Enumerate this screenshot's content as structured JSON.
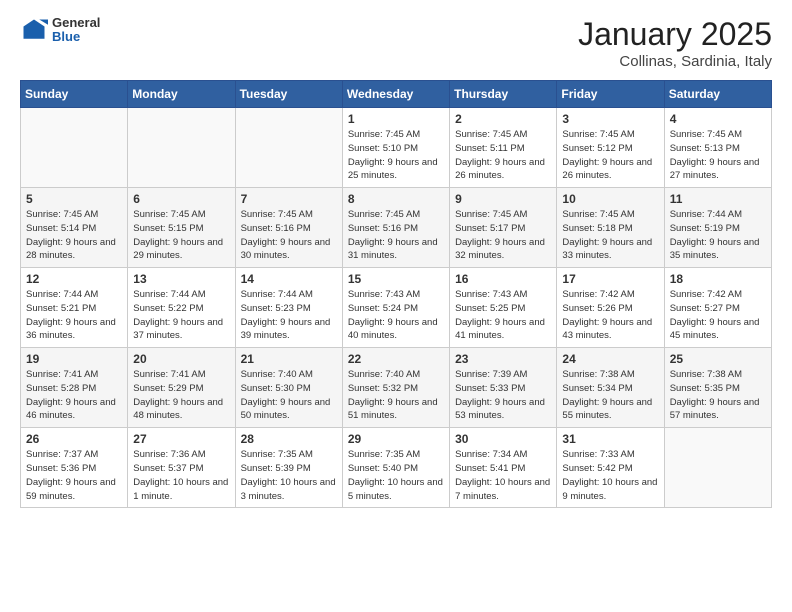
{
  "header": {
    "logo": {
      "general": "General",
      "blue": "Blue"
    },
    "month": "January 2025",
    "location": "Collinas, Sardinia, Italy"
  },
  "weekdays": [
    "Sunday",
    "Monday",
    "Tuesday",
    "Wednesday",
    "Thursday",
    "Friday",
    "Saturday"
  ],
  "weeks": [
    [
      {
        "day": null
      },
      {
        "day": null
      },
      {
        "day": null
      },
      {
        "day": 1,
        "sunrise": "7:45 AM",
        "sunset": "5:10 PM",
        "daylight": "9 hours and 25 minutes."
      },
      {
        "day": 2,
        "sunrise": "7:45 AM",
        "sunset": "5:11 PM",
        "daylight": "9 hours and 26 minutes."
      },
      {
        "day": 3,
        "sunrise": "7:45 AM",
        "sunset": "5:12 PM",
        "daylight": "9 hours and 26 minutes."
      },
      {
        "day": 4,
        "sunrise": "7:45 AM",
        "sunset": "5:13 PM",
        "daylight": "9 hours and 27 minutes."
      }
    ],
    [
      {
        "day": 5,
        "sunrise": "7:45 AM",
        "sunset": "5:14 PM",
        "daylight": "9 hours and 28 minutes."
      },
      {
        "day": 6,
        "sunrise": "7:45 AM",
        "sunset": "5:15 PM",
        "daylight": "9 hours and 29 minutes."
      },
      {
        "day": 7,
        "sunrise": "7:45 AM",
        "sunset": "5:16 PM",
        "daylight": "9 hours and 30 minutes."
      },
      {
        "day": 8,
        "sunrise": "7:45 AM",
        "sunset": "5:16 PM",
        "daylight": "9 hours and 31 minutes."
      },
      {
        "day": 9,
        "sunrise": "7:45 AM",
        "sunset": "5:17 PM",
        "daylight": "9 hours and 32 minutes."
      },
      {
        "day": 10,
        "sunrise": "7:45 AM",
        "sunset": "5:18 PM",
        "daylight": "9 hours and 33 minutes."
      },
      {
        "day": 11,
        "sunrise": "7:44 AM",
        "sunset": "5:19 PM",
        "daylight": "9 hours and 35 minutes."
      }
    ],
    [
      {
        "day": 12,
        "sunrise": "7:44 AM",
        "sunset": "5:21 PM",
        "daylight": "9 hours and 36 minutes."
      },
      {
        "day": 13,
        "sunrise": "7:44 AM",
        "sunset": "5:22 PM",
        "daylight": "9 hours and 37 minutes."
      },
      {
        "day": 14,
        "sunrise": "7:44 AM",
        "sunset": "5:23 PM",
        "daylight": "9 hours and 39 minutes."
      },
      {
        "day": 15,
        "sunrise": "7:43 AM",
        "sunset": "5:24 PM",
        "daylight": "9 hours and 40 minutes."
      },
      {
        "day": 16,
        "sunrise": "7:43 AM",
        "sunset": "5:25 PM",
        "daylight": "9 hours and 41 minutes."
      },
      {
        "day": 17,
        "sunrise": "7:42 AM",
        "sunset": "5:26 PM",
        "daylight": "9 hours and 43 minutes."
      },
      {
        "day": 18,
        "sunrise": "7:42 AM",
        "sunset": "5:27 PM",
        "daylight": "9 hours and 45 minutes."
      }
    ],
    [
      {
        "day": 19,
        "sunrise": "7:41 AM",
        "sunset": "5:28 PM",
        "daylight": "9 hours and 46 minutes."
      },
      {
        "day": 20,
        "sunrise": "7:41 AM",
        "sunset": "5:29 PM",
        "daylight": "9 hours and 48 minutes."
      },
      {
        "day": 21,
        "sunrise": "7:40 AM",
        "sunset": "5:30 PM",
        "daylight": "9 hours and 50 minutes."
      },
      {
        "day": 22,
        "sunrise": "7:40 AM",
        "sunset": "5:32 PM",
        "daylight": "9 hours and 51 minutes."
      },
      {
        "day": 23,
        "sunrise": "7:39 AM",
        "sunset": "5:33 PM",
        "daylight": "9 hours and 53 minutes."
      },
      {
        "day": 24,
        "sunrise": "7:38 AM",
        "sunset": "5:34 PM",
        "daylight": "9 hours and 55 minutes."
      },
      {
        "day": 25,
        "sunrise": "7:38 AM",
        "sunset": "5:35 PM",
        "daylight": "9 hours and 57 minutes."
      }
    ],
    [
      {
        "day": 26,
        "sunrise": "7:37 AM",
        "sunset": "5:36 PM",
        "daylight": "9 hours and 59 minutes."
      },
      {
        "day": 27,
        "sunrise": "7:36 AM",
        "sunset": "5:37 PM",
        "daylight": "10 hours and 1 minute."
      },
      {
        "day": 28,
        "sunrise": "7:35 AM",
        "sunset": "5:39 PM",
        "daylight": "10 hours and 3 minutes."
      },
      {
        "day": 29,
        "sunrise": "7:35 AM",
        "sunset": "5:40 PM",
        "daylight": "10 hours and 5 minutes."
      },
      {
        "day": 30,
        "sunrise": "7:34 AM",
        "sunset": "5:41 PM",
        "daylight": "10 hours and 7 minutes."
      },
      {
        "day": 31,
        "sunrise": "7:33 AM",
        "sunset": "5:42 PM",
        "daylight": "10 hours and 9 minutes."
      },
      {
        "day": null
      }
    ]
  ]
}
